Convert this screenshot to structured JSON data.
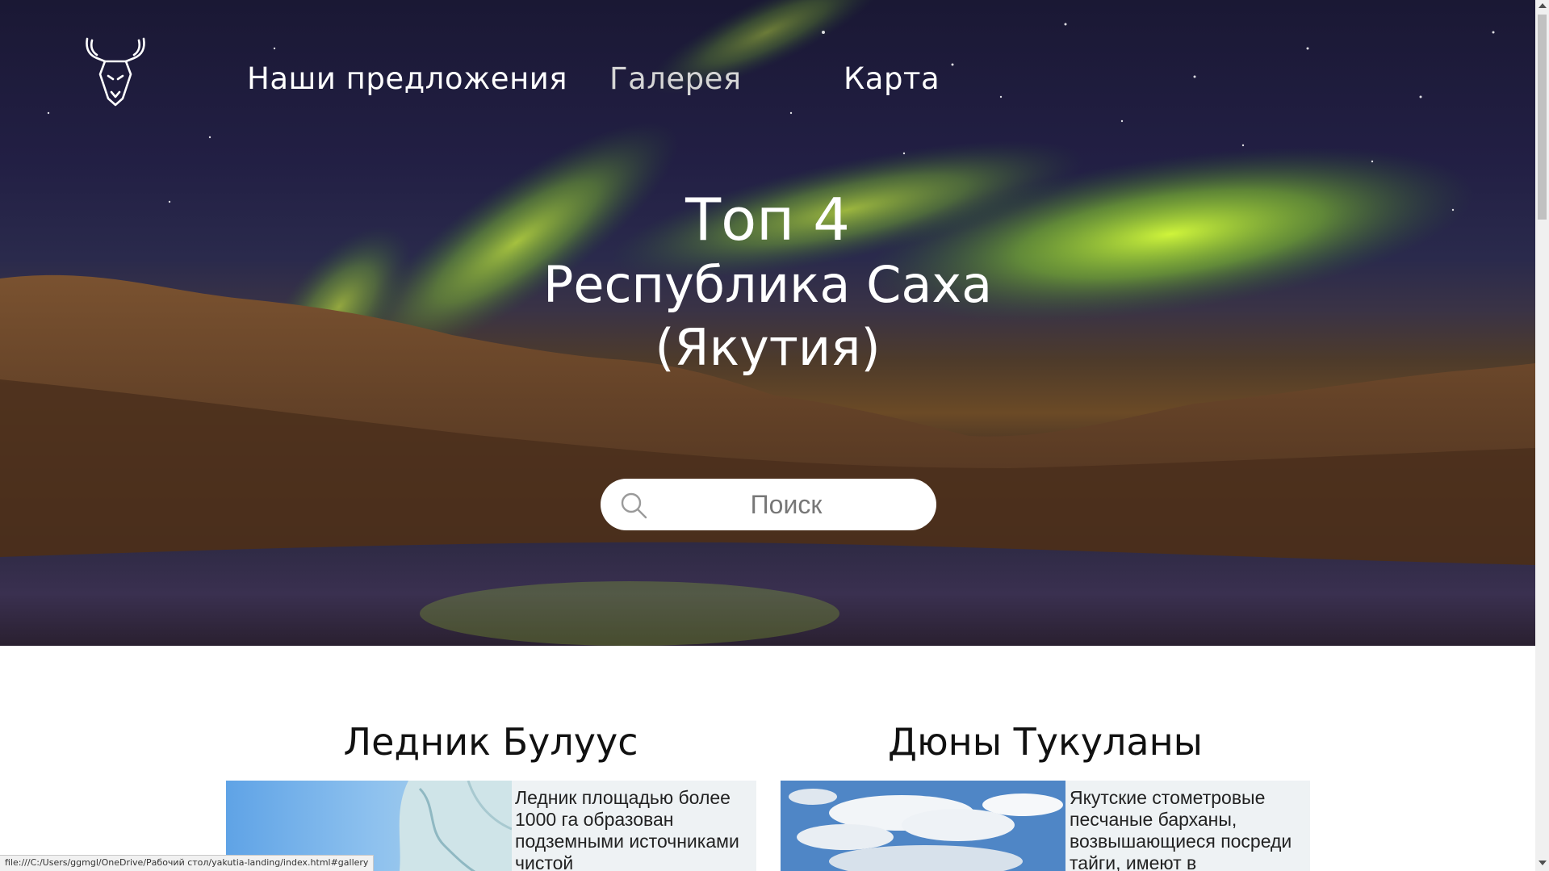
{
  "nav": {
    "items": [
      {
        "label": "Наши предложения"
      },
      {
        "label": "Галерея"
      },
      {
        "label": "Карта"
      }
    ]
  },
  "hero": {
    "title_line1": "Топ 4",
    "title_line2": "Республика Саха",
    "title_line3": "(Якутия)"
  },
  "search": {
    "placeholder": "Поиск"
  },
  "cards": [
    {
      "title": "Ледник Булуус",
      "text": "Ледник площадью более 1000 га образован подземными источниками чистой"
    },
    {
      "title": "Дюны Тукуланы",
      "text": "Якутские стометровые песчаные барханы, возвышающиеся посреди тайги, имеют в"
    }
  ],
  "statusbar": {
    "url": "file:///C:/Users/ggmgl/OneDrive/Рабочий стол/yakutia-landing/index.html#gallery"
  },
  "colors": {
    "aurora": "#b8f23a",
    "sky": "#1f1d3f",
    "hills": "#6b4a26"
  }
}
